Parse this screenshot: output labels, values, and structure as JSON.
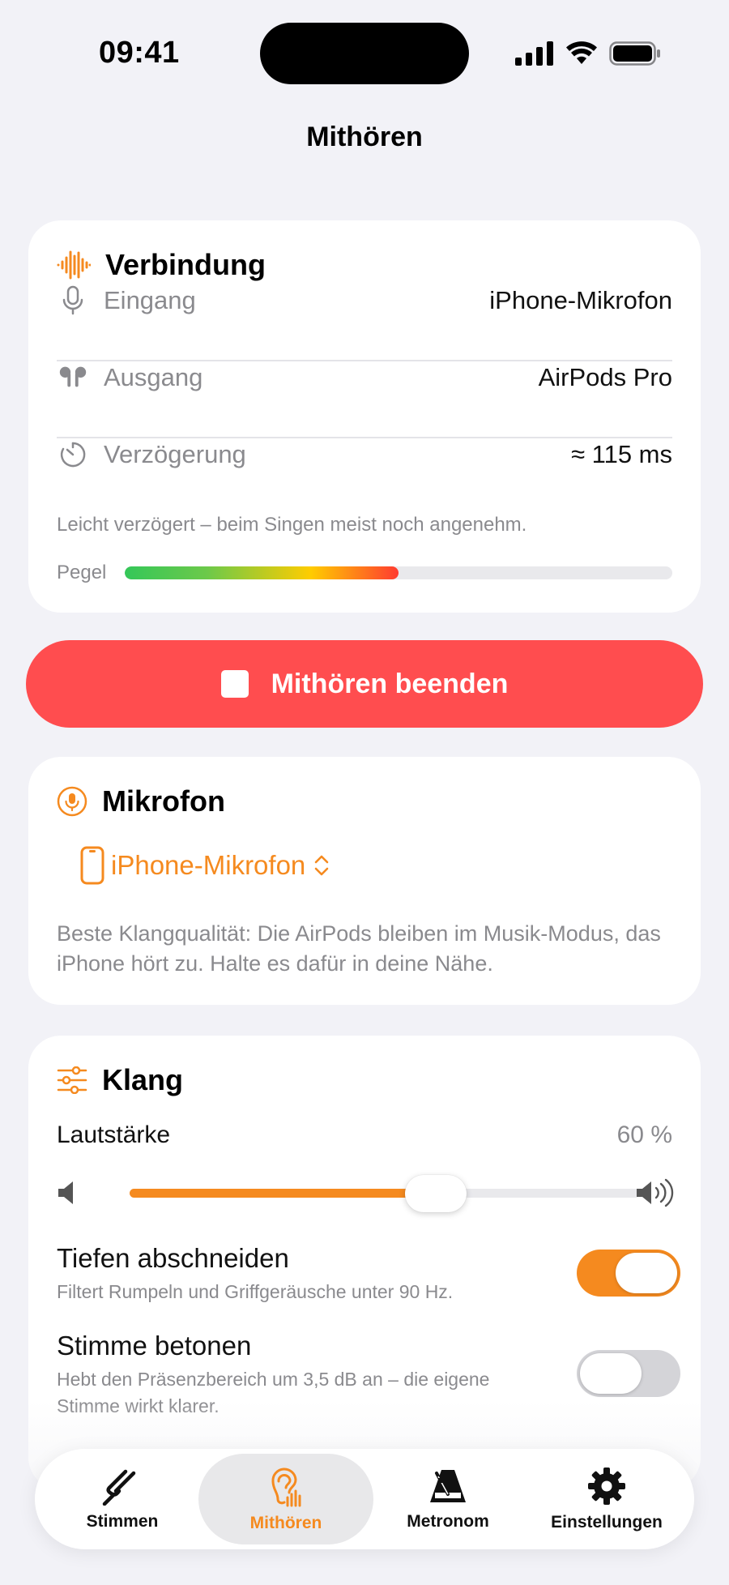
{
  "status_bar": {
    "time": "09:41"
  },
  "nav": {
    "title": "Mithören"
  },
  "connection": {
    "header": "Verbindung",
    "rows": [
      {
        "label": "Eingang",
        "value": "iPhone-Mikrofon",
        "icon": "microphone-icon"
      },
      {
        "label": "Ausgang",
        "value": "AirPods Pro",
        "icon": "airpods-icon"
      },
      {
        "label": "Verzögerung",
        "value": "≈ 115 ms",
        "icon": "timer-icon"
      }
    ],
    "hint": "Leicht verzögert – beim Singen meist noch angenehm.",
    "level_label": "Pegel",
    "level_fraction": 0.5
  },
  "stop_button": {
    "label": "Mithören beenden"
  },
  "microphone": {
    "header": "Mikrofon",
    "selected": "iPhone-Mikrofon",
    "description": "Beste Klangqualität: Die AirPods bleiben im Musik-Modus, das iPhone hört zu. Halte es dafür in deine Nähe."
  },
  "sound": {
    "header": "Klang",
    "volume_label": "Lautstärke",
    "volume_value": "60 %",
    "volume_fraction": 0.6,
    "toggles": [
      {
        "title": "Tiefen abschneiden",
        "subtitle": "Filtert Rumpeln und Griffgeräusche unter 90 Hz.",
        "on": true
      },
      {
        "title": "Stimme betonen",
        "subtitle": "Hebt den Präsenzbereich um 3,5 dB an – die eigene Stimme wirkt klarer.",
        "on": false
      }
    ]
  },
  "tabs": [
    {
      "label": "Stimmen",
      "icon": "tuning-fork-icon",
      "active": false
    },
    {
      "label": "Mithören",
      "icon": "ear-icon",
      "active": true
    },
    {
      "label": "Metronom",
      "icon": "metronome-icon",
      "active": false
    },
    {
      "label": "Einstellungen",
      "icon": "gear-icon",
      "active": false
    }
  ],
  "colors": {
    "accent": "#f58a1f",
    "stop": "#ff4d4f",
    "background": "#f2f2f7"
  }
}
